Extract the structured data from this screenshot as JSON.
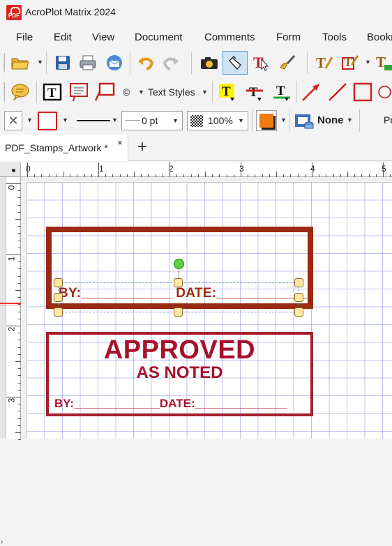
{
  "app": {
    "title": "AcroPlot Matrix 2024",
    "logo_text": "PDF"
  },
  "menu": [
    "File",
    "Edit",
    "View",
    "Document",
    "Comments",
    "Form",
    "Tools",
    "Bookr"
  ],
  "toolbar2": {
    "symbol": "©",
    "text_styles": "Text Styles"
  },
  "toolbar3": {
    "line_width": "0 pt",
    "opacity": "100%",
    "fill_label": "None",
    "properties_partial": "Pr"
  },
  "tab": {
    "label": "PDF_Stamps_Artwork *",
    "close": "×",
    "new": "+"
  },
  "ruler": {
    "top": [
      "0",
      "1",
      "2",
      "3",
      "4",
      "5"
    ],
    "left": [
      "0",
      "1",
      "2",
      "3"
    ]
  },
  "stamp1": {
    "fields": "BY:____________ DATE:____________"
  },
  "stamp2": {
    "title": "APPROVED",
    "subtitle": "AS NOTED",
    "fields": "BY:_____________DATE:______________"
  },
  "colors": {
    "stamp1_border": "#9a2b12",
    "stamp2_red": "#a8102b",
    "grid": "#8c8ce6",
    "selection_handle": "#fde7a3",
    "rotate_handle": "#5bd13e"
  }
}
